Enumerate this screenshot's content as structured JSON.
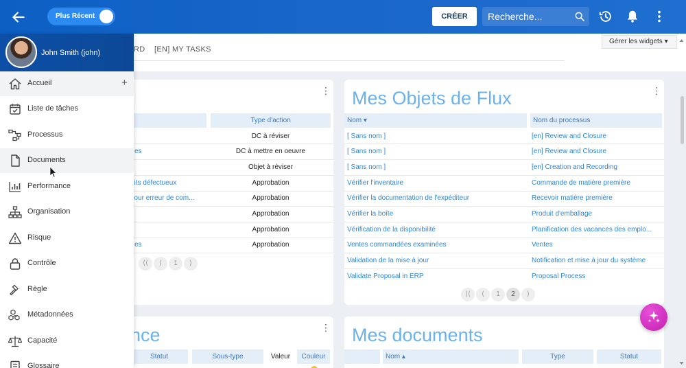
{
  "topbar": {
    "toggle_label": "Plus Récent",
    "create_label": "CRÉER",
    "search_placeholder": "Recherche..."
  },
  "tabs": {
    "tab1": "RD",
    "tab2": "[EN] MY TASKS",
    "widgets_button": "Gérer les widgets ▾"
  },
  "sidebar": {
    "user": "John Smith (john)",
    "items": [
      {
        "label": "Accueil",
        "icon": "home-icon"
      },
      {
        "label": "Liste de tâches",
        "icon": "calendar-check-icon"
      },
      {
        "label": "Processus",
        "icon": "process-icon"
      },
      {
        "label": "Documents",
        "icon": "document-icon"
      },
      {
        "label": "Performance",
        "icon": "bar-chart-icon"
      },
      {
        "label": "Organisation",
        "icon": "org-chart-icon"
      },
      {
        "label": "Risque",
        "icon": "warning-icon"
      },
      {
        "label": "Contrôle",
        "icon": "lock-icon"
      },
      {
        "label": "Règle",
        "icon": "gavel-icon"
      },
      {
        "label": "Métadonnées",
        "icon": "cubes-icon"
      },
      {
        "label": "Capacité",
        "icon": "scale-icon"
      },
      {
        "label": "Glossaire",
        "icon": "glossary-icon"
      }
    ]
  },
  "left_card": {
    "header": "Type d'action",
    "rows": [
      {
        "name": "",
        "type": "DC à réviser"
      },
      {
        "name": "es",
        "type": "DC à mettre en oeuvre"
      },
      {
        "name": "",
        "type": "Objet à réviser"
      },
      {
        "name": "uits défectueux",
        "type": "Approbation"
      },
      {
        "name": "pour erreur de com...",
        "type": "Approbation"
      },
      {
        "name": "",
        "type": "Approbation"
      },
      {
        "name": "",
        "type": "Approbation"
      },
      {
        "name": "es",
        "type": "Approbation"
      }
    ],
    "pagination": {
      "first": "⟨⟨",
      "prev": "⟨",
      "page1": "1",
      "next": "⟩"
    }
  },
  "flux_card": {
    "title": "Mes Objets de Flux",
    "col_name": "Nom ▾",
    "col_process": "Nom du processus",
    "rows": [
      {
        "name": "[ Sans nom ]",
        "process": "[en] Review and Closure"
      },
      {
        "name": "[ Sans nom ]",
        "process": "[en] Review and Closure"
      },
      {
        "name": "[ Sans nom ]",
        "process": "[en] Creation and Recording"
      },
      {
        "name": "Vérifier l'inventaire",
        "process": "Commande de matière première"
      },
      {
        "name": "Vérifier la documentation de l'expéditeur",
        "process": "Recevoir matière première"
      },
      {
        "name": "Vérifier la boîte",
        "process": "Produit d'emballage"
      },
      {
        "name": "Vérification de la disponibilité",
        "process": "Planification des vacances des emplo..."
      },
      {
        "name": "Ventes commandées examinées",
        "process": "Ventes"
      },
      {
        "name": "Validation de la mise à jour",
        "process": "Notification et mise à jour du système"
      },
      {
        "name": "Validate Proposal in ERP",
        "process": "Proposal Process"
      }
    ],
    "pagination": {
      "first": "⟨⟨",
      "prev": "⟨",
      "page1": "1",
      "page2": "2",
      "next": "⟩"
    }
  },
  "bottom_left_card": {
    "title": "nce",
    "col_statut": "Statut",
    "col_soustype": "Sous-type",
    "col_valeur": "Valeur",
    "col_couleur": "Couleur"
  },
  "documents_card": {
    "title": "Mes documents",
    "col_nom": "Nom ▴",
    "col_type": "Type",
    "col_statut": "Statut"
  }
}
